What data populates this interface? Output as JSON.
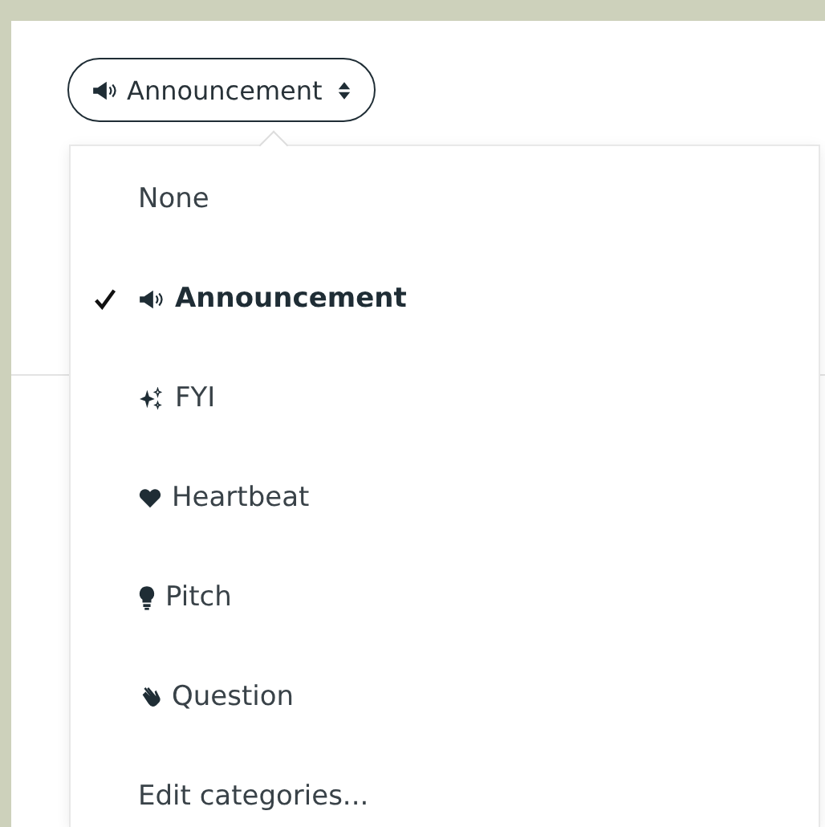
{
  "category_button": {
    "kind": "megaphone",
    "label": "Announcement"
  },
  "menu": {
    "items": [
      {
        "kind": "plain",
        "label": "None",
        "selected": false
      },
      {
        "kind": "megaphone",
        "label": "Announcement",
        "selected": true
      },
      {
        "kind": "sparkles",
        "label": "FYI",
        "selected": false
      },
      {
        "kind": "heart",
        "label": "Heartbeat",
        "selected": false
      },
      {
        "kind": "bulb",
        "label": "Pitch",
        "selected": false
      },
      {
        "kind": "hand",
        "label": "Question",
        "selected": false
      }
    ],
    "edit_link": "Edit categories..."
  }
}
